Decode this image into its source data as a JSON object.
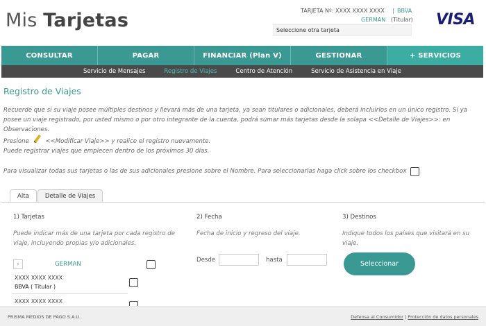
{
  "header": {
    "logo_light": "Mis",
    "logo_bold": "Tarjetas",
    "card_label": "TARJETA Nº: XXXX XXXX XXXX",
    "separator": "|",
    "bank": "BBVA",
    "holder": "GERMAN",
    "role": "(Titular)",
    "select_placeholder": "Seleccione otra tarjeta",
    "brand": "VISA"
  },
  "nav": {
    "items": [
      "CONSULTAR",
      "PAGAR",
      "FINANCIAR (Plan V)",
      "GESTIONAR",
      "+ SERVICIOS"
    ]
  },
  "subnav": {
    "items": [
      "Servicio de Mensajes",
      "Registro de Viajes",
      "Centro de Atención",
      "Servicio de Asistencia en Viaje"
    ],
    "active_index": 1
  },
  "page": {
    "title": "Registro de Viajes",
    "intro_1": "Recuerde que si su viaje posee múltiples destinos y llevará más de una tarjeta, ya sean titulares o adicionales, deberá incluirlos en un único registro. Si ya posee un viaje registrado, por usted mismo o por otro integrante de la cuenta, podrá sumar más tarjetas desde la solapa <<Detalle de Viajes>>: en Observaciones.",
    "intro_2a": "Presione",
    "intro_2b": "<<Modificar Viaje>> y realice el registro nuevamente.",
    "intro_3": "Puede registrar viajes que empiecen dentro de los próximos 30 días.",
    "visualize": "Para visualizar todas sus tarjetas o las de sus adicionales presione sobre el Nombre. Para seleccionarlas haga click sobre los checkbox"
  },
  "tabs": [
    "Alta",
    "Detalle de Viajes"
  ],
  "cards_section": {
    "title": "1) Tarjetas",
    "desc": "Puede indicar más de una tarjeta por cada registro de viaje, incluyendo propias y/o adicionales.",
    "expand_label": "›",
    "holder": "GERMAN",
    "cards": [
      {
        "number": "XXXX XXXX XXXX",
        "bank": "BBVA ( Titular )"
      },
      {
        "number": "XXXX XXXX XXXX",
        "bank": ""
      }
    ]
  },
  "date_section": {
    "title": "2) Fecha",
    "desc": "Fecha de inicio y regreso del viaje.",
    "from_label": "Desde",
    "to_label": "hasta",
    "from_value": "",
    "to_value": ""
  },
  "dest_section": {
    "title": "3) Destinos",
    "desc": "Indique todos los países que visitará en su viaje.",
    "button": "Seleccionar"
  },
  "footer": {
    "company": "PRISMA MEDIOS DE PAGO S.A.U.",
    "link_1": "Defensa al Consumidor",
    "separator": "|",
    "link_2": "Protección de datos personales"
  },
  "colors": {
    "accent": "#3a9a93",
    "subnav_bg": "#4a4a4a",
    "visa_blue": "#1a1f71"
  }
}
